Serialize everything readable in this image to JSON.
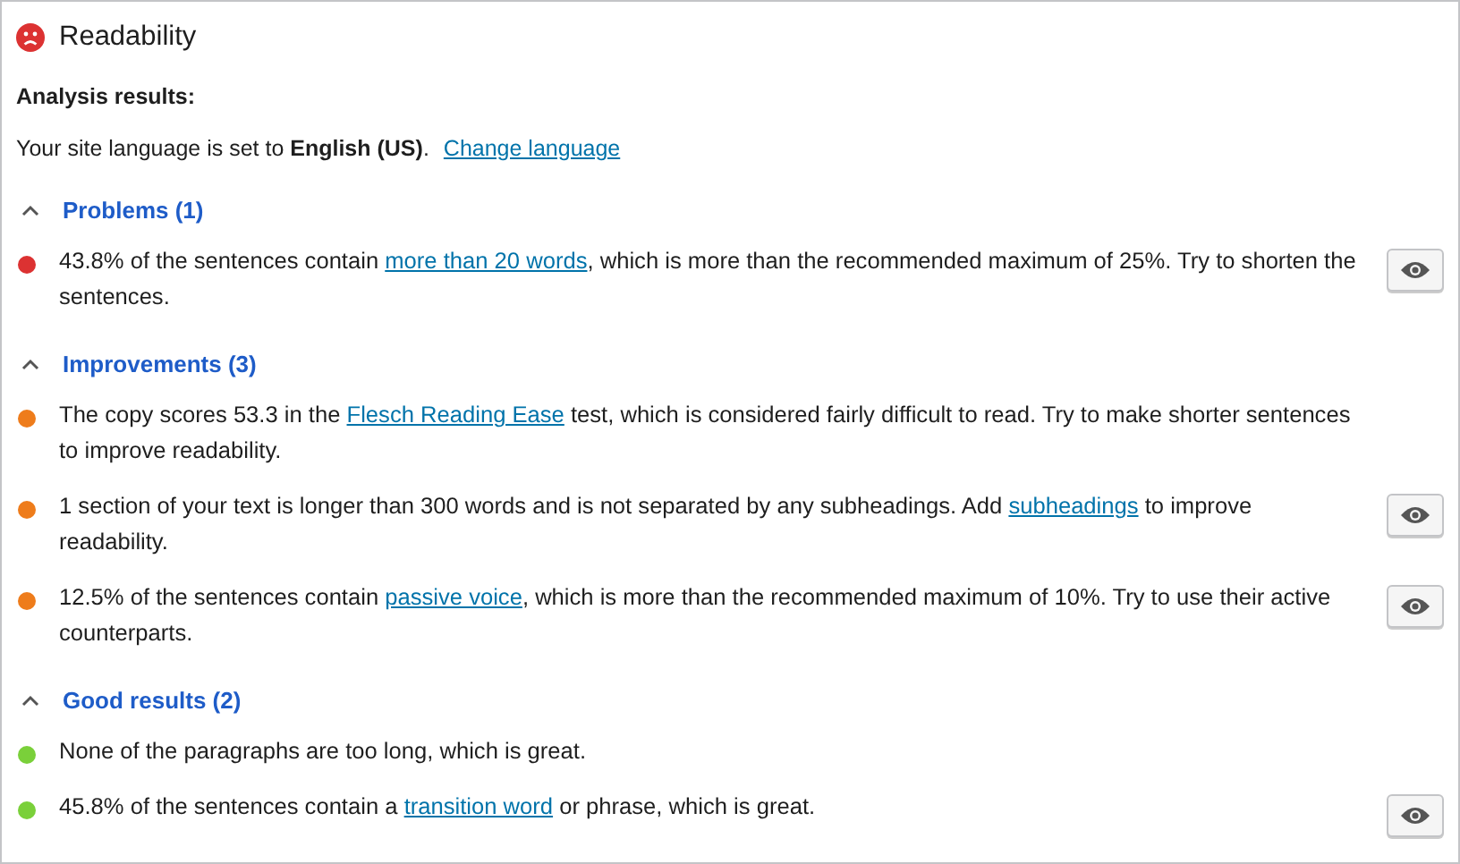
{
  "header": {
    "title": "Readability",
    "color": "#dc3232"
  },
  "analysis_heading": "Analysis results:",
  "language": {
    "before": "Your site language is set to ",
    "language": "English (US)",
    "after": ".",
    "link": "Change language"
  },
  "sections": [
    {
      "title": "Problems (1)",
      "expanded": true,
      "results": [
        {
          "color": "#dc3232",
          "before": "43.8% of the sentences contain ",
          "link": "more than 20 words",
          "after": ", which is more than the recommended maximum of 25%. Try to shorten the sentences.",
          "eye_button": true
        }
      ]
    },
    {
      "title": "Improvements (3)",
      "expanded": true,
      "results": [
        {
          "color": "#ee7c1b",
          "before": "The copy scores 53.3 in the ",
          "link": "Flesch Reading Ease",
          "after": " test, which is considered fairly difficult to read. Try to make shorter sentences to improve readability.",
          "eye_button": false
        },
        {
          "color": "#ee7c1b",
          "before": "1 section of your text is longer than 300 words and is not separated by any subheadings. Add ",
          "link": "subheadings",
          "after": " to improve readability.",
          "eye_button": true
        },
        {
          "color": "#ee7c1b",
          "before": "12.5% of the sentences contain ",
          "link": "passive voice",
          "after": ", which is more than the recommended maximum of 10%. Try to use their active counterparts.",
          "eye_button": true
        }
      ]
    },
    {
      "title": "Good results (2)",
      "expanded": true,
      "results": [
        {
          "color": "#7ad03a",
          "before": "None of the paragraphs are too long, which is great.",
          "eye_button": false
        },
        {
          "color": "#7ad03a",
          "before": "45.8% of the sentences contain a ",
          "link": "transition word",
          "after": " or phrase, which is great.",
          "eye_button": true
        }
      ]
    }
  ]
}
